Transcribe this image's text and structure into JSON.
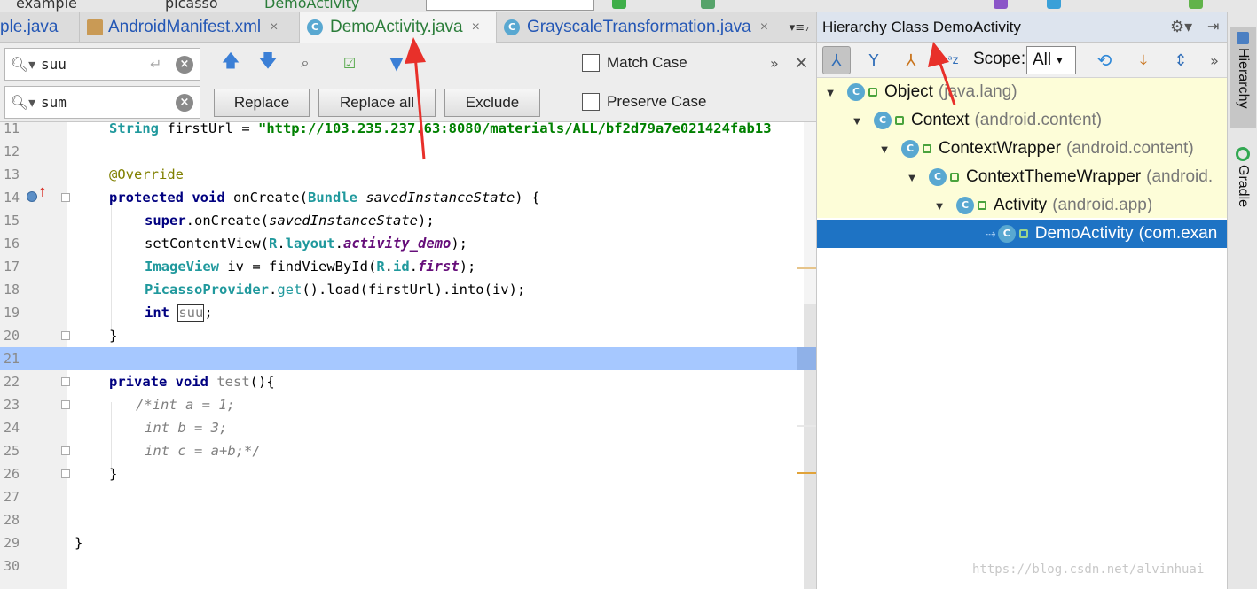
{
  "topbar": {
    "crumb1": "example",
    "crumb2": "picasso",
    "crumb3": "DemoActivity"
  },
  "tabs": [
    {
      "label": "ple.java",
      "icon": "java-class-icon"
    },
    {
      "label": "AndroidManifest.xml",
      "icon": "xml-file-icon"
    },
    {
      "label": "DemoActivity.java",
      "icon": "java-class-icon",
      "active": true
    },
    {
      "label": "GrayscaleTransformation.java",
      "icon": "java-class-icon"
    }
  ],
  "tab_close": "×",
  "tab_menu": "▾≡₇",
  "find": {
    "search_value": "suu",
    "replace_value": "sum",
    "replace_label": "Replace",
    "replace_all_label": "Replace all",
    "exclude_label": "Exclude",
    "match_case_label": "Match Case",
    "preserve_case_label": "Preserve Case",
    "more": "»",
    "close": "×"
  },
  "code_lines": [
    {
      "n": "11"
    },
    {
      "n": "12"
    },
    {
      "n": "13"
    },
    {
      "n": "14"
    },
    {
      "n": "15"
    },
    {
      "n": "16"
    },
    {
      "n": "17"
    },
    {
      "n": "18"
    },
    {
      "n": "19"
    },
    {
      "n": "20"
    },
    {
      "n": "21"
    },
    {
      "n": "22"
    },
    {
      "n": "23"
    },
    {
      "n": "24"
    },
    {
      "n": "25"
    },
    {
      "n": "26"
    },
    {
      "n": "27"
    },
    {
      "n": "28"
    },
    {
      "n": "29"
    },
    {
      "n": "30"
    }
  ],
  "code": {
    "l11_type": "String",
    "l11_var": " firstUrl = ",
    "l11_str": "\"http://103.235.237.63:8080/materials/ALL/bf2d79a7e021424fab13",
    "l13": "@Override",
    "l14_kw": "protected void ",
    "l14_fn": "onCreate(",
    "l14_type": "Bundle ",
    "l14_param": "savedInstanceState",
    "l14_end": ") {",
    "l15_kw": "super",
    "l15_a": ".onCreate(",
    "l15_param": "savedInstanceState",
    "l15_end": ");",
    "l16_a": "setContentView(",
    "l16_r": "R",
    "l16_dot": ".",
    "l16_layout": "layout",
    "l16_dot2": ".",
    "l16_field": "activity_demo",
    "l16_end": ");",
    "l17_type": "ImageView",
    "l17_a": " iv = findViewById(",
    "l17_r": "R",
    "l17_dot": ".",
    "l17_id": "id",
    "l17_dot2": ".",
    "l17_field": "first",
    "l17_end": ");",
    "l18_type": "PicassoProvider",
    "l18_a": ".",
    "l18_get": "get",
    "l18_b": "().load(firstUrl).into(iv);",
    "l19_kw": "int ",
    "l19_var": "suu",
    "l19_end": ";",
    "l20": "}",
    "l22_kw": "private void ",
    "l22_fn": "test",
    "l22_end": "(){",
    "l23": "/*int a = 1;",
    "l24": "int b = 3;",
    "l25": "int c = a+b;*/",
    "l26": "}",
    "l29": "}"
  },
  "hierarchy": {
    "title": "Hierarchy Class DemoActivity",
    "scope_label": "Scope:",
    "scope_value": "All",
    "more": "»",
    "nodes": [
      {
        "name": "Object",
        "pkg": "(java.lang)"
      },
      {
        "name": "Context",
        "pkg": "(android.content)"
      },
      {
        "name": "ContextWrapper",
        "pkg": "(android.content)"
      },
      {
        "name": "ContextThemeWrapper",
        "pkg": "(android."
      },
      {
        "name": "Activity",
        "pkg": "(android.app)"
      },
      {
        "name": "DemoActivity",
        "pkg": "(com.exan"
      }
    ]
  },
  "side_tabs": {
    "hierarchy": "Hierarchy",
    "gradle": "Gradle"
  },
  "watermark": "https://blog.csdn.net/alvinhuai",
  "colors": {
    "selection": "#1e73c4",
    "line_highlight": "#a6c8ff",
    "arrow": "#e8302a"
  }
}
